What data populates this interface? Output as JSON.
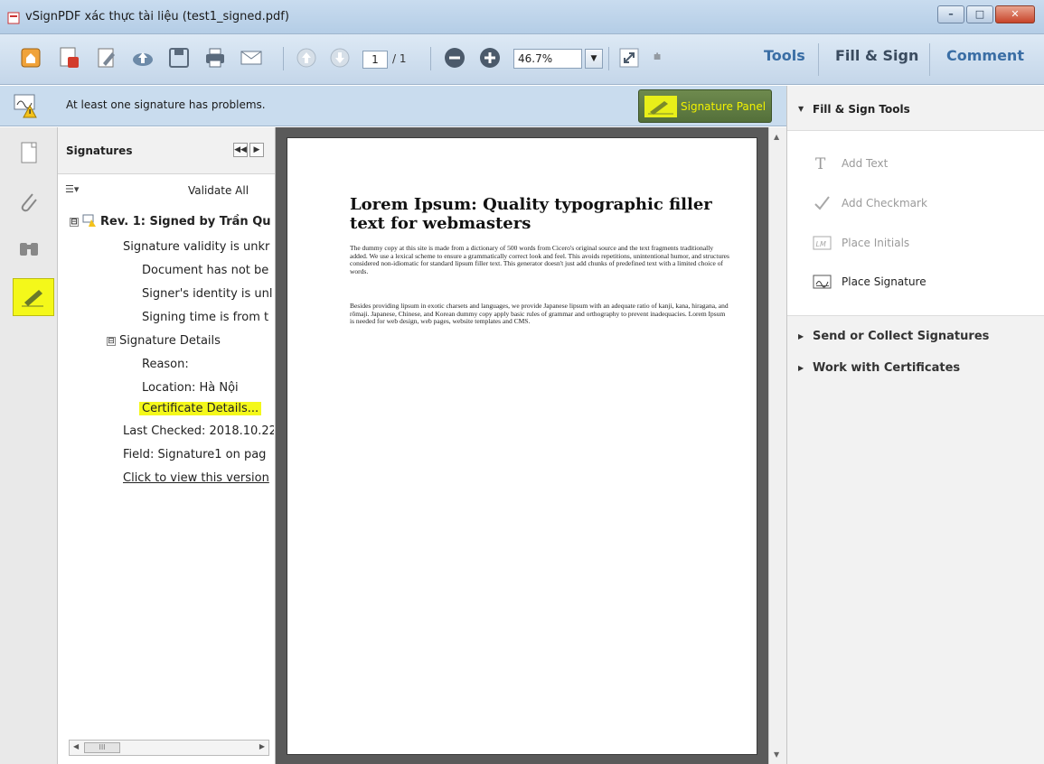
{
  "window": {
    "title": "vSignPDF xác thực tài liệu (test1_signed.pdf)",
    "minimize": "–",
    "maximize": "□",
    "close": "✕"
  },
  "toolbar": {
    "page_current": "1",
    "page_total": "/ 1",
    "zoom": "46.7%",
    "zoom_caret": "▼",
    "overflow": "⩧",
    "tabs": {
      "tools": "Tools",
      "fill_sign": "Fill & Sign",
      "comment": "Comment"
    }
  },
  "notification": {
    "message": "At least one signature has problems.",
    "signature_panel_button": "Signature Panel",
    "highlight_color": "#f4f81a"
  },
  "signatures_panel": {
    "title": "Signatures",
    "nav_collapse": "◀◀",
    "nav_expand": "▶",
    "options": "☰▾",
    "validate_all": "Validate All",
    "tree": {
      "rev_toggle": "⊟",
      "rev_label": "Rev. 1: Signed by Trần Qu",
      "validity": "Signature validity is unkr",
      "doc_modified": "Document has not be",
      "identity": "Signer's identity is unl",
      "signing_time": "Signing time is from t",
      "details_toggle": "⊟",
      "details_label": "Signature Details",
      "reason": "Reason:",
      "location": "Location: Hà Nội",
      "certificate_details": "Certificate Details...",
      "last_checked": "Last Checked: 2018.10.22",
      "field": "Field: Signature1 on pag",
      "view_version": "Click to view this version"
    },
    "scroll_left": "◀",
    "scroll_right": "▶",
    "scroll_thumb": "III"
  },
  "document": {
    "title": "Lorem Ipsum: Quality typographic filler text for webmasters",
    "para1": "The dummy copy at this site is made from a dictionary of 500 words from Cicero's original source and the text fragments traditionally added. We use a lexical scheme to ensure a grammatically correct look and feel. This avoids repetitions, unintentional humor, and structures considered non-idiomatic for standard lipsum filler text. This generator doesn't just add chunks of predefined text with a limited choice of words.",
    "para2": "Besides providing lipsum in exotic charsets and languages, we provide Japanese lipsum with an adequate ratio of kanji, kana, hiragana, and rōmaji. Japanese, Chinese, and Korean dummy copy apply basic rules of grammar and orthography to prevent inadequacies. Lorem Ipsum is needed for web design, web pages, website templates and CMS."
  },
  "right_pane": {
    "header": "Fill & Sign Tools",
    "header_arrow": "▼",
    "tools": {
      "add_text": "Add Text",
      "add_checkmark": "Add Checkmark",
      "place_initials": "Place Initials",
      "place_signature": "Place Signature"
    },
    "sections": {
      "send_collect": "Send or Collect Signatures",
      "certificates": "Work with Certificates",
      "arrow": "▶"
    }
  },
  "colors": {
    "accent_blue": "#3a6ea5",
    "highlight_yellow": "#f4f81a",
    "sig_button_green": "#5f7b44"
  }
}
